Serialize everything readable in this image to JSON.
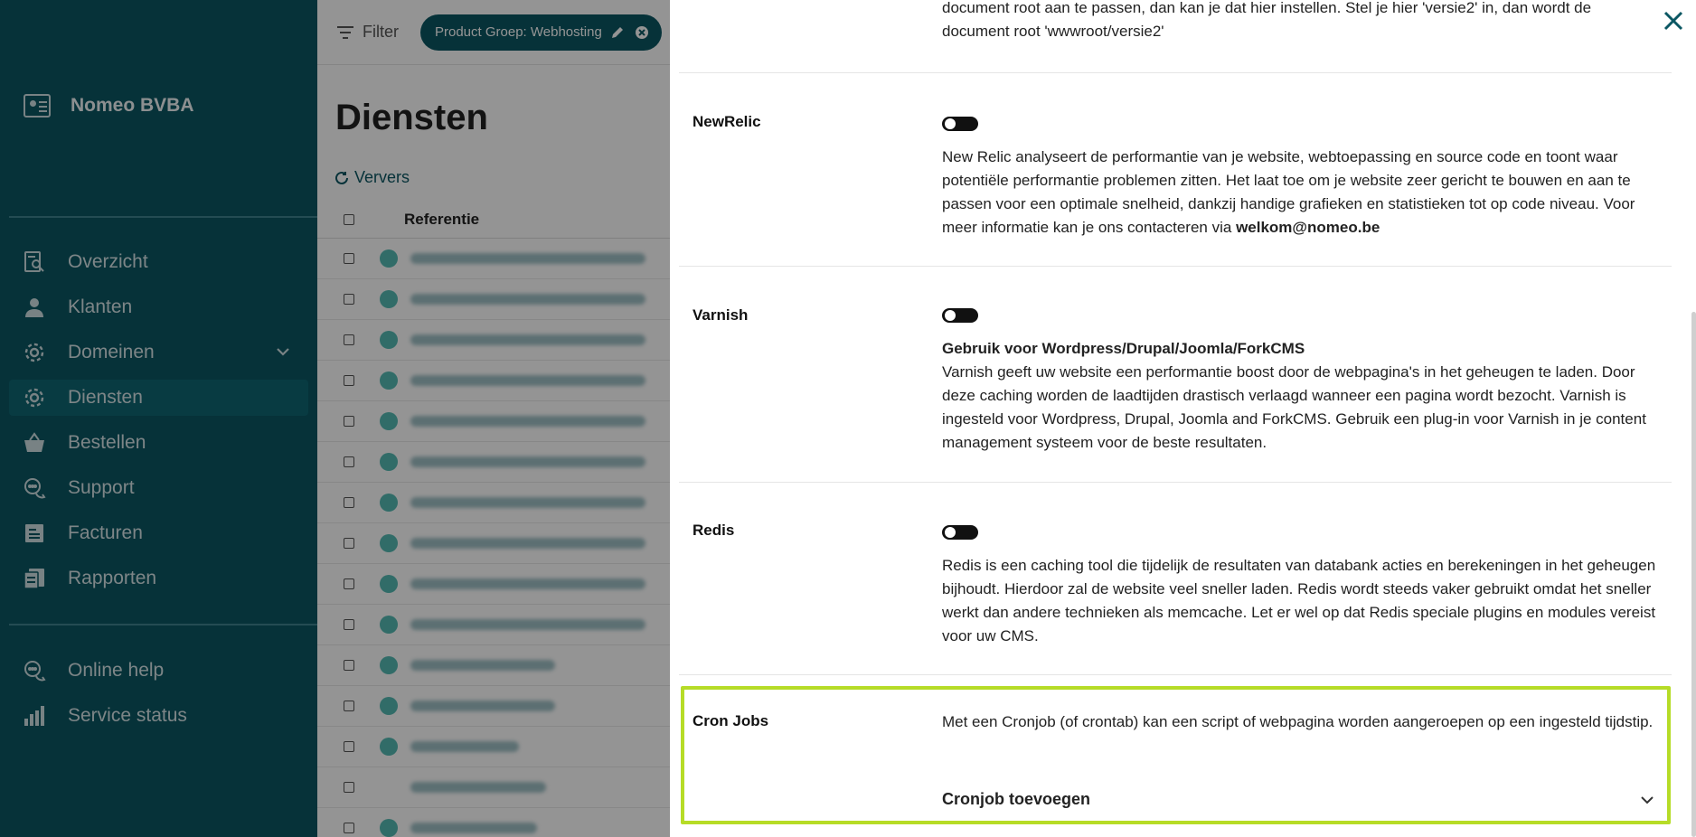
{
  "sidebar": {
    "brand": "Nomeo BVBA",
    "items": [
      {
        "label": "Overzicht",
        "icon": "overview-icon"
      },
      {
        "label": "Klanten",
        "icon": "customers-icon"
      },
      {
        "label": "Domeinen",
        "icon": "domains-gear-icon"
      },
      {
        "label": "Diensten",
        "icon": "services-gear-icon"
      },
      {
        "label": "Bestellen",
        "icon": "basket-icon"
      },
      {
        "label": "Support",
        "icon": "support-chat-icon"
      },
      {
        "label": "Facturen",
        "icon": "invoice-icon"
      },
      {
        "label": "Rapporten",
        "icon": "reports-icon"
      }
    ],
    "footer_items": [
      {
        "label": "Online help",
        "icon": "help-chat-icon"
      },
      {
        "label": "Service status",
        "icon": "bar-chart-icon"
      }
    ]
  },
  "main": {
    "filter_label": "Filter",
    "chip_label": "Product Groep: Webhosting",
    "title": "Diensten",
    "refresh_label": "Ververs",
    "column_header": "Referentie"
  },
  "drawer": {
    "top_text": "document root aan te passen, dan kan je dat hier instellen. Stel je hier 'versie2' in, dan wordt de document root 'wwwroot/versie2'",
    "newrelic": {
      "title": "NewRelic",
      "text": "New Relic analyseert de performantie van je website, webtoepassing en source code en toont waar potentiële performantie problemen zitten. Het laat toe om je website zeer gericht te bouwen en aan te passen voor een optimale snelheid, dankzij handige grafieken en statistieken tot op code niveau. Voor meer informatie kan je ons contacteren via ",
      "email": "welkom@nomeo.be"
    },
    "varnish": {
      "title": "Varnish",
      "subtitle": "Gebruik voor Wordpress/Drupal/Joomla/ForkCMS",
      "text": "Varnish geeft uw website een performantie boost door de webpagina's in het geheugen te laden. Door deze caching worden de laadtijden drastisch verlaagd wanneer een pagina wordt bezocht. Varnish is ingesteld voor Wordpress, Drupal, Joomla and ForkCMS. Gebruik een plug-in voor Varnish in je content management systeem voor de beste resultaten."
    },
    "redis": {
      "title": "Redis",
      "text": "Redis is een caching tool die tijdelijk de resultaten van databank acties en berekeningen in het geheugen bijhoudt. Hierdoor zal de website veel sneller laden. Redis wordt steeds vaker gebruikt omdat het sneller werkt dan andere technieken als memcache. Let er wel op dat Redis speciale plugins en modules vereist voor uw CMS."
    },
    "cron": {
      "title": "Cron Jobs",
      "text": "Met een Cronjob (of crontab) kan een script of webpagina worden aangeroepen op een ingesteld tijdstip.",
      "add_label": "Cronjob toevoegen"
    },
    "accent_color": "#b6dc27"
  }
}
